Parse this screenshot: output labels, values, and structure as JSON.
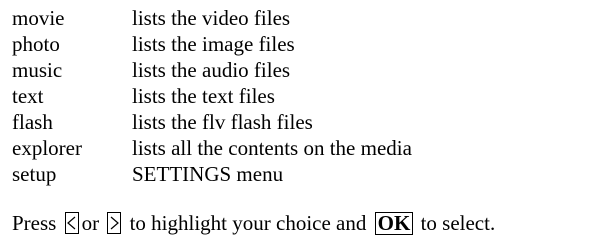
{
  "menu": {
    "items": [
      {
        "term": "movie",
        "description": "lists the video files"
      },
      {
        "term": "photo",
        "description": "lists the image files"
      },
      {
        "term": "music",
        "description": "lists the audio files"
      },
      {
        "term": "text",
        "description": "lists the text files"
      },
      {
        "term": "flash",
        "description": "lists the flv flash files"
      },
      {
        "term": "explorer",
        "description": "lists all the contents on the media"
      },
      {
        "term": "setup",
        "description": "SETTINGS menu"
      }
    ]
  },
  "instruction": {
    "press": "Press",
    "left_key_icon": "left-arrow-key-icon",
    "or": "or",
    "right_key_icon": "right-arrow-key-icon",
    "middle": "to highlight your choice and",
    "ok_key": "OK",
    "end": "to select."
  }
}
